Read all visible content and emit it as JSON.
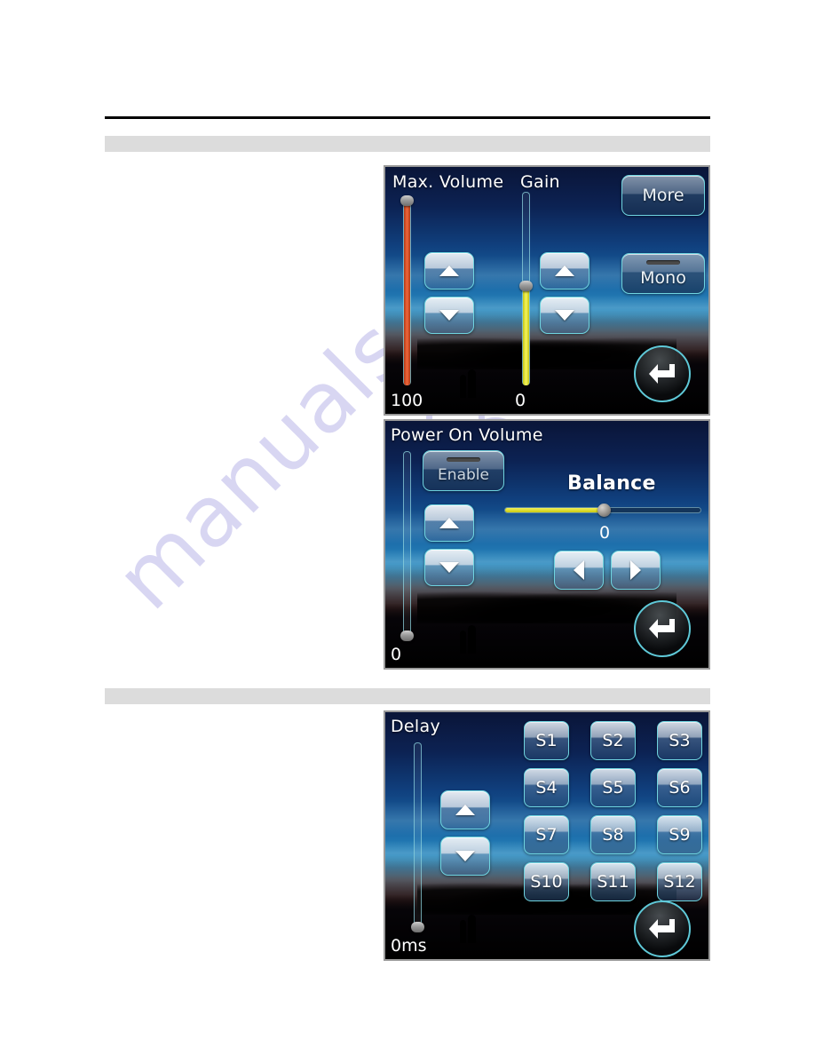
{
  "document": {
    "background_color": "#ffffff",
    "rule_color": "#000000",
    "gray_bar_color": "#dcdcdc",
    "watermark": {
      "text": "manuals",
      "color": "#b9b6e8"
    }
  },
  "theme": {
    "screen_border": "#9a9a9a",
    "button_border": "#6fd4e0",
    "accent_cyan": "#6fd4e0",
    "slider_yellow": "#e8e81e",
    "slider_orange": "#e8552a",
    "text_white": "#ffffff"
  },
  "screens": [
    {
      "id": "max-volume-gain",
      "labels": {
        "max_volume": "Max. Volume",
        "gain": "Gain"
      },
      "sliders": [
        {
          "name": "max-volume-slider",
          "value": "100",
          "fill_color": "#e8552a",
          "fill_percent": 100,
          "knob_percent": 100
        },
        {
          "name": "gain-slider",
          "value": "0",
          "fill_color": "#e8e81e",
          "fill_percent": 55,
          "knob_percent": 55
        }
      ],
      "buttons": {
        "max_volume_up": "▲",
        "max_volume_down": "▼",
        "gain_up": "▲",
        "gain_down": "▼",
        "more": "More",
        "mono": "Mono",
        "back": "back-arrow"
      }
    },
    {
      "id": "power-on-volume",
      "labels": {
        "title": "Power On Volume",
        "balance": "Balance"
      },
      "sliders": [
        {
          "name": "power-on-volume-slider",
          "value": "0",
          "fill_color": "none",
          "fill_percent": 0,
          "knob_percent": 0
        },
        {
          "name": "balance-slider",
          "value": "0",
          "fill_color": "#e8e81e",
          "fill_percent": 50,
          "knob_percent": 50
        }
      ],
      "buttons": {
        "enable": "Enable",
        "volume_up": "▲",
        "volume_down": "▼",
        "balance_left": "◀",
        "balance_right": "▶",
        "back": "back-arrow"
      }
    },
    {
      "id": "delay",
      "labels": {
        "title": "Delay"
      },
      "sliders": [
        {
          "name": "delay-slider",
          "value": "0ms",
          "fill_color": "none",
          "fill_percent": 0,
          "knob_percent": 0
        }
      ],
      "buttons": {
        "delay_up": "▲",
        "delay_down": "▼",
        "back": "back-arrow"
      },
      "speaker_grid": {
        "rows": 4,
        "cols": 3,
        "items": [
          "S1",
          "S2",
          "S3",
          "S4",
          "S5",
          "S6",
          "S7",
          "S8",
          "S9",
          "S10",
          "S11",
          "S12"
        ]
      }
    }
  ]
}
